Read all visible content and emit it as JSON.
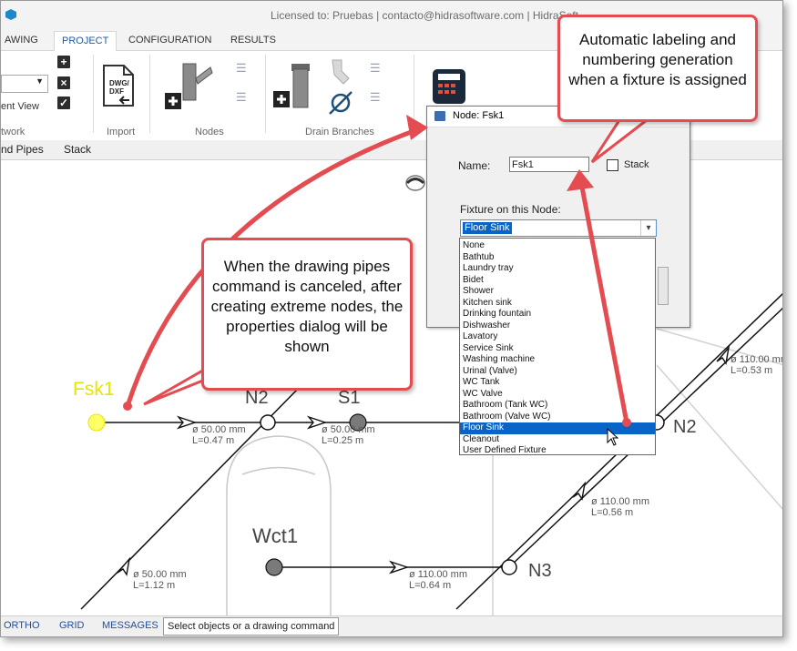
{
  "window": {
    "title": "Licensed to: Pruebas | contacto@hidrasoftware.com | HidraSoft"
  },
  "ribbon_tabs": [
    "AWING",
    "PROJECT",
    "CONFIGURATION",
    "RESULTS"
  ],
  "ribbon": {
    "view_text": "ent View",
    "groups": {
      "network": "twork",
      "import": "Import",
      "nodes": "Nodes",
      "drain_branches": "Drain Branches"
    },
    "import_icon_text": "DWG/\nDXF"
  },
  "subtabs": [
    "nd Pipes",
    "Stack"
  ],
  "canvas": {
    "labels": {
      "fsk1": "Fsk1",
      "n2": "N2",
      "n3": "N3",
      "wct1": "Wct1",
      "n2_partial": "N2",
      "node_partial": "S1"
    },
    "pipes": [
      {
        "diameter": "ø 50.00 mm",
        "length": "L=0.47 m"
      },
      {
        "diameter": "ø 50.00 mm",
        "length": "L=0.25 m"
      },
      {
        "diameter": "ø 110.00 mm",
        "length": "L=0.53 m"
      },
      {
        "diameter": "ø 110.00 mm",
        "length": "L=0.56 m"
      },
      {
        "diameter": "ø 50.00 mm",
        "length": "L=1.12 m"
      },
      {
        "diameter": "ø 110.00 mm",
        "length": "L=0.64 m"
      }
    ]
  },
  "dialog": {
    "title": "Node: Fsk1",
    "name_label": "Name:",
    "name_value": "Fsk1",
    "stack_label": "Stack",
    "fixture_label": "Fixture on this Node:",
    "fixture_selected": "Floor Sink",
    "fixture_options": [
      "None",
      "Bathtub",
      "Laundry tray",
      "Bidet",
      "Shower",
      "Kitchen sink",
      "Drinking fountain",
      "Dishwasher",
      "Lavatory",
      "Service Sink",
      "Washing machine",
      "Urinal (Valve)",
      "WC Tank",
      "WC Valve",
      "Bathroom (Tank WC)",
      "Bathroom (Valve WC)",
      "Floor Sink",
      "Cleanout",
      "User Defined Fixture"
    ],
    "selected_index": 16
  },
  "callouts": {
    "left": "When the drawing pipes command is canceled, after creating extreme nodes, the properties dialog will be shown",
    "right": "Automatic labeling and numbering generation when a fixture is assigned"
  },
  "statusbar": {
    "ortho": "ORTHO",
    "grid": "GRID",
    "messages": "MESSAGES",
    "prompt": "Select objects or a drawing command"
  },
  "colors": {
    "accent": "#1e5aa8",
    "callout_border": "#e34c50",
    "selection": "#0a64c8",
    "highlight_node": "#ffff66"
  }
}
